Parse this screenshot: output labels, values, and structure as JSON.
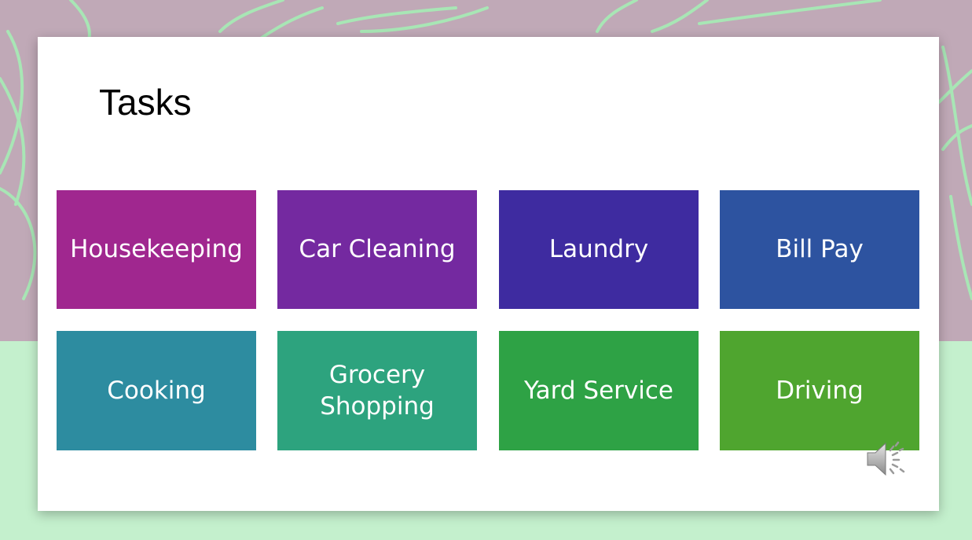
{
  "slide": {
    "title": "Tasks"
  },
  "colors": {
    "background_top": "#c0a9b7",
    "background_bottom": "#c4f0cd",
    "leaf": "#a8e6b5"
  },
  "tiles": [
    {
      "label": "Housekeeping",
      "color": "#a0278f"
    },
    {
      "label": "Car Cleaning",
      "color": "#7429a0"
    },
    {
      "label": "Laundry",
      "color": "#3e2ba0"
    },
    {
      "label": "Bill Pay",
      "color": "#2d53a0"
    },
    {
      "label": "Cooking",
      "color": "#2d8ca0"
    },
    {
      "label": "Grocery Shopping",
      "color": "#2da37e"
    },
    {
      "label": "Yard Service",
      "color": "#2ea245"
    },
    {
      "label": "Driving",
      "color": "#4fa52f"
    }
  ],
  "icons": {
    "audio": "speaker-icon"
  }
}
